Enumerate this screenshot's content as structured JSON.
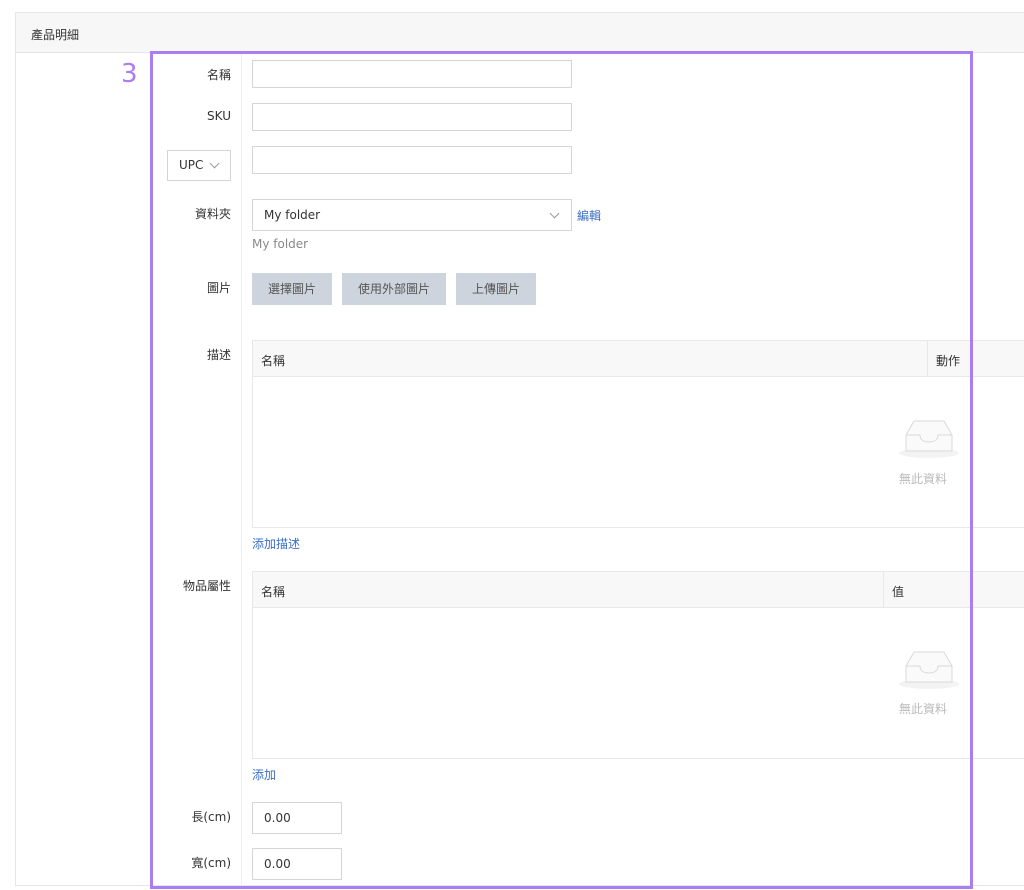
{
  "panel": {
    "title": "產品明細"
  },
  "step": "3",
  "fields": {
    "name_label": "名稱",
    "name_value": "",
    "sku_label": "SKU",
    "sku_value": "",
    "code_type": "UPC",
    "code_value": "",
    "folder_label": "資料夾",
    "folder_value": "My folder",
    "folder_edit": "編輯",
    "folder_hint": "My folder",
    "image_label": "圖片",
    "image_buttons": [
      "選擇圖片",
      "使用外部圖片",
      "上傳圖片"
    ],
    "length_label": "長(cm)",
    "length_value": "0.00",
    "width_label": "寬(cm)",
    "width_value": "0.00"
  },
  "description": {
    "label": "描述",
    "col_name": "名稱",
    "col_action": "動作",
    "empty": "無此資料",
    "add_link": "添加描述"
  },
  "attributes": {
    "label": "物品屬性",
    "col_name": "名稱",
    "col_value": "值",
    "empty": "無此資料",
    "add_link": "添加"
  },
  "colors": {
    "accent": "#a97ef0",
    "link": "#3a6ec7",
    "button_bg": "#ced4dd"
  }
}
